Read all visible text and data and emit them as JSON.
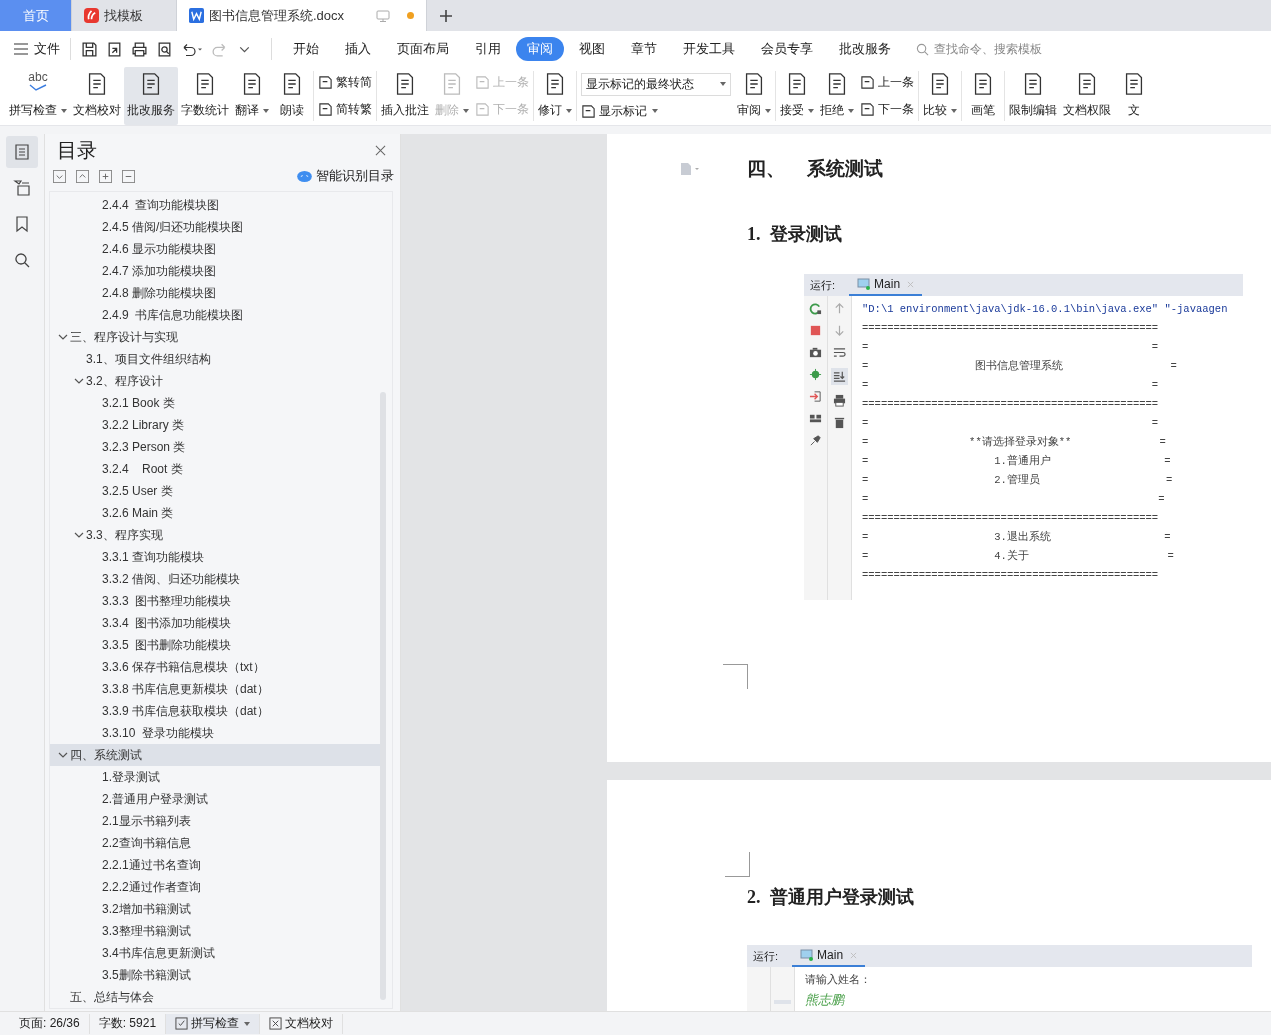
{
  "title_tabs": [
    {
      "label": "首页",
      "kind": "home",
      "selected": false,
      "unsaved": false
    },
    {
      "label": "找模板",
      "kind": "app",
      "selected": false,
      "unsaved": false
    },
    {
      "label": "图书信息管理系统.docx",
      "kind": "doc",
      "selected": true,
      "unsaved": true
    }
  ],
  "menu": {
    "file_label": "文件",
    "tabs": [
      {
        "label": "开始",
        "selected": false
      },
      {
        "label": "插入",
        "selected": false
      },
      {
        "label": "页面布局",
        "selected": false
      },
      {
        "label": "引用",
        "selected": false
      },
      {
        "label": "审阅",
        "selected": true
      },
      {
        "label": "视图",
        "selected": false
      },
      {
        "label": "章节",
        "selected": false
      },
      {
        "label": "开发工具",
        "selected": false
      },
      {
        "label": "会员专享",
        "selected": false
      },
      {
        "label": "批改服务",
        "selected": false
      }
    ],
    "search": {
      "placeholder": "查找命令、搜索模板"
    }
  },
  "ribbon": [
    [
      {
        "kind": "big",
        "label": "拼写检查",
        "icon_text": "abc",
        "caret": true,
        "disabled": false,
        "selected": false
      },
      {
        "kind": "big",
        "label": "文档校对",
        "caret": false,
        "disabled": false,
        "selected": false
      },
      {
        "kind": "big",
        "label": "批改服务",
        "caret": false,
        "disabled": false,
        "selected": true
      },
      {
        "kind": "big",
        "label": "字数统计",
        "caret": false,
        "disabled": false,
        "selected": false
      },
      {
        "kind": "big",
        "label": "翻译",
        "caret": true,
        "disabled": false,
        "selected": false
      },
      {
        "kind": "big",
        "label": "朗读",
        "caret": false,
        "disabled": false,
        "selected": false
      }
    ],
    [
      {
        "kind": "stack",
        "items": [
          {
            "label": "繁转简",
            "disabled": false
          },
          {
            "label": "简转繁",
            "disabled": false
          }
        ]
      }
    ],
    [
      {
        "kind": "big",
        "label": "插入批注",
        "caret": false,
        "disabled": false,
        "selected": false
      },
      {
        "kind": "big",
        "label": "删除",
        "caret": true,
        "disabled": true,
        "selected": false
      },
      {
        "kind": "stack",
        "items": [
          {
            "label": "上一条",
            "disabled": true
          },
          {
            "label": "下一条",
            "disabled": true
          }
        ]
      }
    ],
    [
      {
        "kind": "big",
        "label": "修订",
        "caret": true,
        "disabled": false,
        "selected": false
      }
    ],
    [
      {
        "kind": "select",
        "value": "显示标记的最终状态",
        "below": "显示标记"
      },
      {
        "kind": "big",
        "label": "审阅",
        "caret": true,
        "disabled": false,
        "selected": false
      }
    ],
    [
      {
        "kind": "big",
        "label": "接受",
        "caret": true,
        "disabled": false,
        "selected": false
      },
      {
        "kind": "big",
        "label": "拒绝",
        "caret": true,
        "disabled": false,
        "selected": false
      },
      {
        "kind": "stack",
        "items": [
          {
            "label": "上一条",
            "disabled": false
          },
          {
            "label": "下一条",
            "disabled": false
          }
        ]
      }
    ],
    [
      {
        "kind": "big",
        "label": "比较",
        "caret": true,
        "disabled": false,
        "selected": false
      }
    ],
    [
      {
        "kind": "big",
        "label": "画笔",
        "caret": false,
        "disabled": false,
        "selected": false
      }
    ],
    [
      {
        "kind": "big",
        "label": "限制编辑",
        "caret": false,
        "disabled": false,
        "selected": false
      },
      {
        "kind": "big",
        "label": "文档权限",
        "caret": false,
        "disabled": false,
        "selected": false
      },
      {
        "kind": "big",
        "label": "文",
        "caret": false,
        "disabled": false,
        "selected": false
      }
    ]
  ],
  "side_rail": [
    {
      "kind": "toc",
      "selected": true
    },
    {
      "kind": "nav",
      "selected": false
    },
    {
      "kind": "bookmark",
      "selected": false
    },
    {
      "kind": "search",
      "selected": false
    }
  ],
  "toc": {
    "title": "目录",
    "smart_label": "智能识别目录",
    "items": [
      {
        "kind": "hidden",
        "children": [
          {
            "kind": "hidden",
            "children": [
              {
                "label": "2.4.4  查询功能模块图",
                "selected": false
              },
              {
                "label": "2.4.5 借阅/归还功能模块图",
                "selected": false
              },
              {
                "label": "2.4.6 显示功能模块图",
                "selected": false
              },
              {
                "label": "2.4.7 添加功能模块图",
                "selected": false
              },
              {
                "label": "2.4.8 删除功能模块图",
                "selected": false
              },
              {
                "label": "2.4.9  书库信息功能模块图",
                "selected": false
              }
            ]
          }
        ]
      },
      {
        "label": "三、程序设计与实现",
        "selected": false,
        "expanded": true,
        "children": [
          {
            "label": "3.1、项目文件组织结构",
            "selected": false
          },
          {
            "label": "3.2、程序设计",
            "selected": false,
            "expanded": true,
            "children": [
              {
                "label": "3.2.1 Book 类",
                "selected": false
              },
              {
                "label": "3.2.2 Library 类",
                "selected": false
              },
              {
                "label": "3.2.3 Person 类",
                "selected": false
              },
              {
                "label": "3.2.4    Root 类",
                "selected": false
              },
              {
                "label": "3.2.5 User 类",
                "selected": false
              },
              {
                "label": "3.2.6 Main 类",
                "selected": false
              }
            ]
          },
          {
            "label": "3.3、程序实现",
            "selected": false,
            "expanded": true,
            "children": [
              {
                "label": "3.3.1 查询功能模块",
                "selected": false
              },
              {
                "label": "3.3.2 借阅、归还功能模块",
                "selected": false
              },
              {
                "label": "3.3.3  图书整理功能模块",
                "selected": false
              },
              {
                "label": "3.3.4  图书添加功能模块",
                "selected": false
              },
              {
                "label": "3.3.5  图书删除功能模块",
                "selected": false
              },
              {
                "label": "3.3.6 保存书籍信息模块（txt）",
                "selected": false
              },
              {
                "label": "3.3.8 书库信息更新模块（dat）",
                "selected": false
              },
              {
                "label": "3.3.9 书库信息获取模块（dat）",
                "selected": false
              },
              {
                "label": "3.3.10  登录功能模块",
                "selected": false
              }
            ]
          }
        ]
      },
      {
        "label": "四、系统测试",
        "selected": true,
        "expanded": true,
        "children": [
          {
            "kind": "hidden",
            "children": [
              {
                "label": "1.登录测试",
                "selected": false
              },
              {
                "label": "2.普通用户登录测试",
                "selected": false
              },
              {
                "label": "2.1显示书籍列表",
                "selected": false
              },
              {
                "label": "2.2查询书籍信息",
                "selected": false
              },
              {
                "label": "2.2.1通过书名查询",
                "selected": false
              },
              {
                "label": "2.2.2通过作者查询",
                "selected": false
              },
              {
                "label": "3.2增加书籍测试",
                "selected": false
              },
              {
                "label": "3.3整理书籍测试",
                "selected": false
              },
              {
                "label": "3.4书库信息更新测试",
                "selected": false
              },
              {
                "label": "3.5删除书籍测试",
                "selected": false
              }
            ]
          }
        ]
      },
      {
        "label": "五、总结与体会",
        "selected": false
      }
    ]
  },
  "document": {
    "pages": [
      {
        "blocks": [
          {
            "kind": "chapter",
            "number": "四、",
            "text": "系统测试"
          },
          {
            "kind": "heading",
            "number": "1.",
            "text": "登录测试"
          },
          {
            "kind": "console",
            "indent": true,
            "run_label": "运行:",
            "tab": "Main",
            "lines": [
              {
                "kind": "command",
                "text": "\"D:\\1 environment\\java\\jdk-16.0.1\\bin\\java.exe\" \"-javaagen"
              },
              {
                "kind": "output",
                "text": "==============================================="
              },
              {
                "kind": "output",
                "text": "=                                             ="
              },
              {
                "kind": "output",
                "text": "=                 图书信息管理系统                 ="
              },
              {
                "kind": "output",
                "text": "=                                             ="
              },
              {
                "kind": "output",
                "text": "==============================================="
              },
              {
                "kind": "output",
                "text": "=                                             ="
              },
              {
                "kind": "output",
                "text": "=                **请选择登录对象**              ="
              },
              {
                "kind": "output",
                "text": "=                    1.普通用户                  ="
              },
              {
                "kind": "output",
                "text": "=                    2.管理员                    ="
              },
              {
                "kind": "output",
                "text": "=                                              ="
              },
              {
                "kind": "output",
                "text": "==============================================="
              },
              {
                "kind": "output",
                "text": "=                    3.退出系统                  ="
              },
              {
                "kind": "output",
                "text": "=                    4.关于                      ="
              },
              {
                "kind": "output",
                "text": "==============================================="
              }
            ]
          },
          {
            "kind": "corner"
          }
        ]
      },
      {
        "blocks": [
          {
            "kind": "corner"
          },
          {
            "kind": "heading",
            "number": "2.",
            "text": "普通用户登录测试"
          },
          {
            "kind": "console",
            "indent": false,
            "run_label": "运行:",
            "tab": "Main",
            "lines": [
              {
                "kind": "output",
                "text": "请输入姓名："
              },
              {
                "kind": "input",
                "text": "熊志鹏"
              }
            ]
          }
        ]
      }
    ]
  },
  "status_bar": {
    "page": "页面: 26/36",
    "words": "字数: 5921",
    "spell": "拼写检查",
    "proof": "文档校对"
  }
}
